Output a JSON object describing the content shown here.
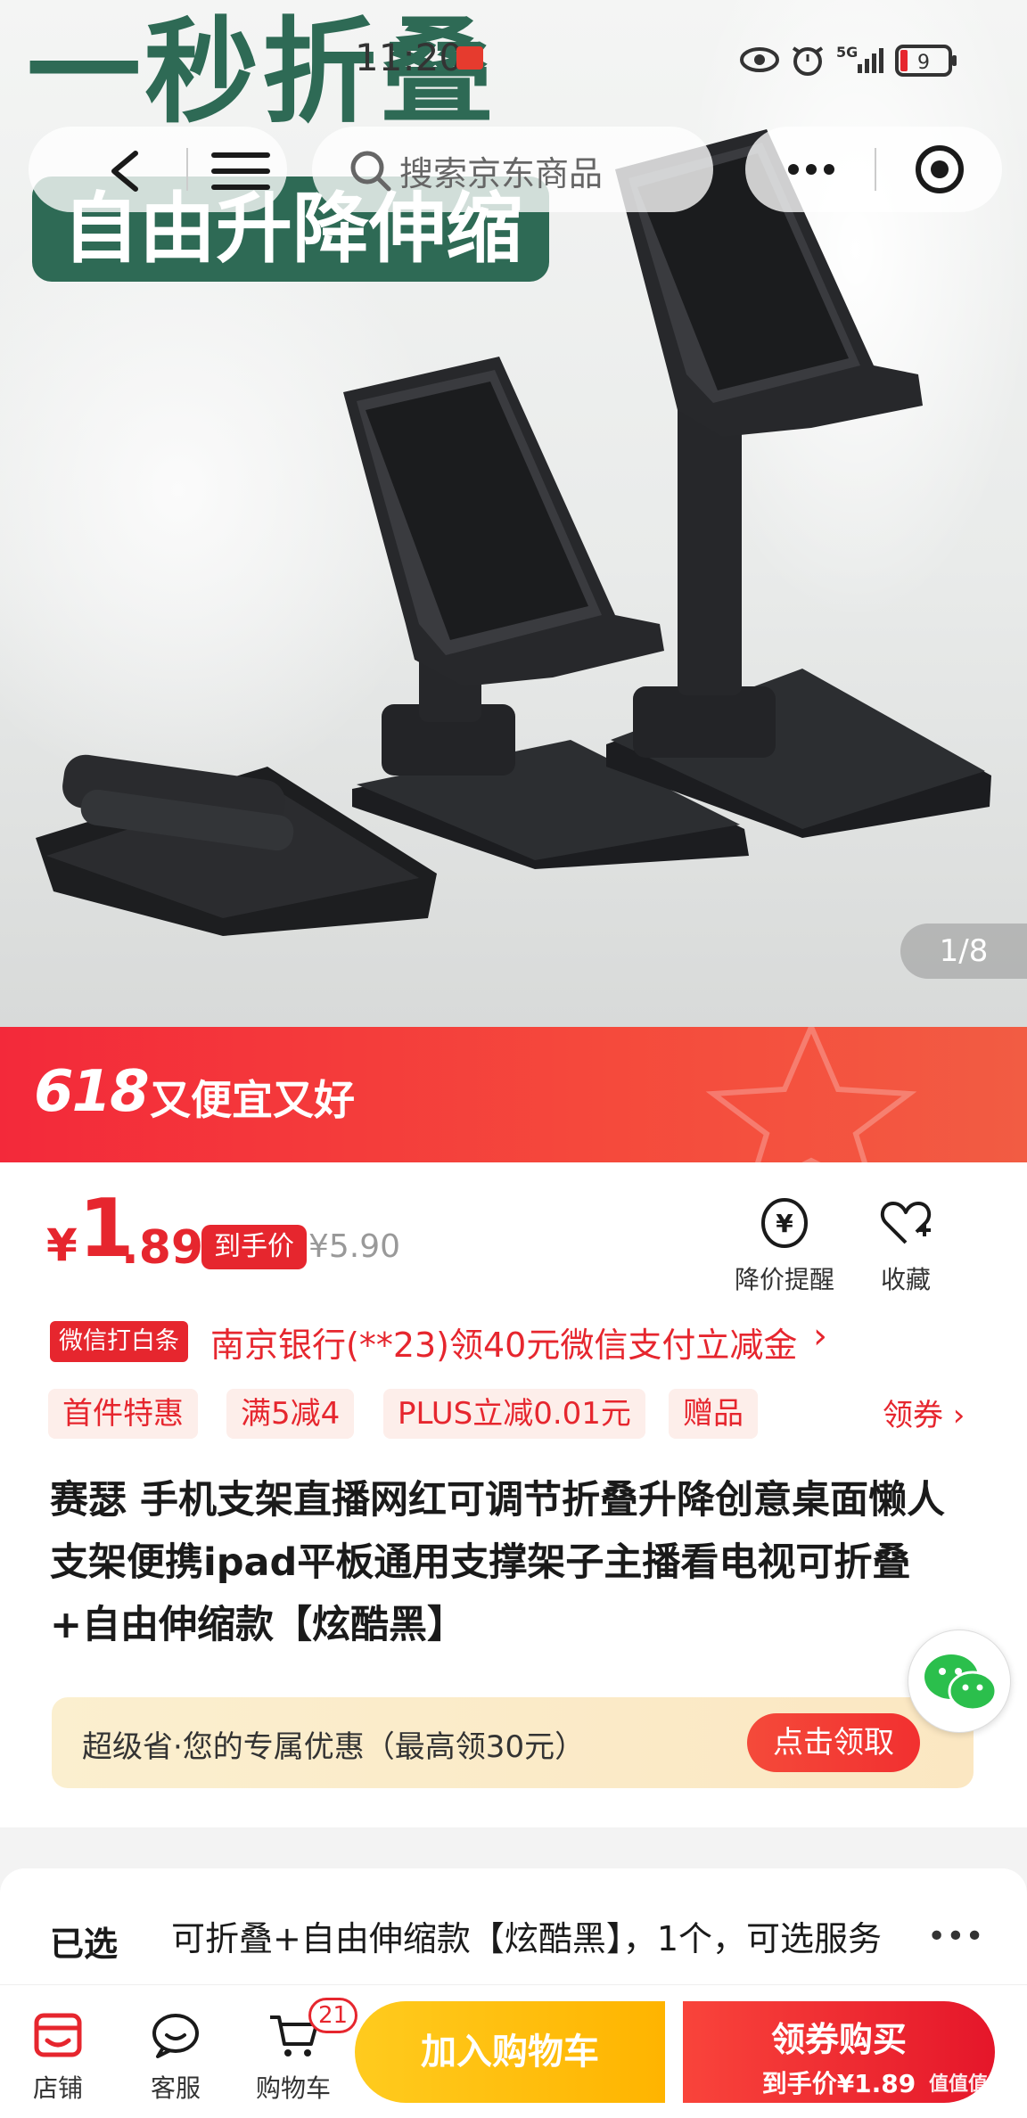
{
  "status_bar": {
    "time": "11:20",
    "network": "5G",
    "battery": "9"
  },
  "nav": {
    "search_placeholder": "搜索京东商品"
  },
  "hero": {
    "title": "一秒折叠",
    "badge": "自由升降伸缩",
    "image_counter": "1/8"
  },
  "promo_banner": {
    "tag": "618",
    "text": "又便宜又好"
  },
  "price": {
    "currency": "¥",
    "integer": "1",
    "decimal": ".89",
    "tag": "到手价",
    "original": "¥5.90"
  },
  "actions": {
    "price_alert": "降价提醒",
    "favorite": "收藏"
  },
  "bank_offer": {
    "tag": "微信打白条",
    "text": "南京银行(**23)领40元微信支付立减金",
    "arrow": "›"
  },
  "coupons": {
    "items": [
      "首件特惠",
      "满5减4",
      "PLUS立减0.01元",
      "赠品"
    ],
    "get_label": "领券 ›"
  },
  "product": {
    "title": "赛瑟 手机支架直播网红可调节折叠升降创意桌面懒人支架便携ipad平板通用支撑架子主播看电视可折叠+自由伸缩款【炫酷黑】"
  },
  "saver": {
    "text": "超级省·您的专属优惠（最高领30元）",
    "button": "点击领取"
  },
  "selection": {
    "label": "已选",
    "value": "可折叠+自由伸缩款【炫酷黑】，1个，可选服务",
    "more": "•••"
  },
  "bottom_bar": {
    "shop": "店铺",
    "service": "客服",
    "cart": "购物车",
    "cart_count": "21",
    "add_to_cart": "加入购物车",
    "buy_line1": "领券购买",
    "buy_line2": "到手价¥1.89"
  },
  "watermark": "值值值",
  "colors": {
    "brand_red": "#e6262e",
    "hero_green": "#2e6a55",
    "cart_yellow": "#ffbf10"
  }
}
